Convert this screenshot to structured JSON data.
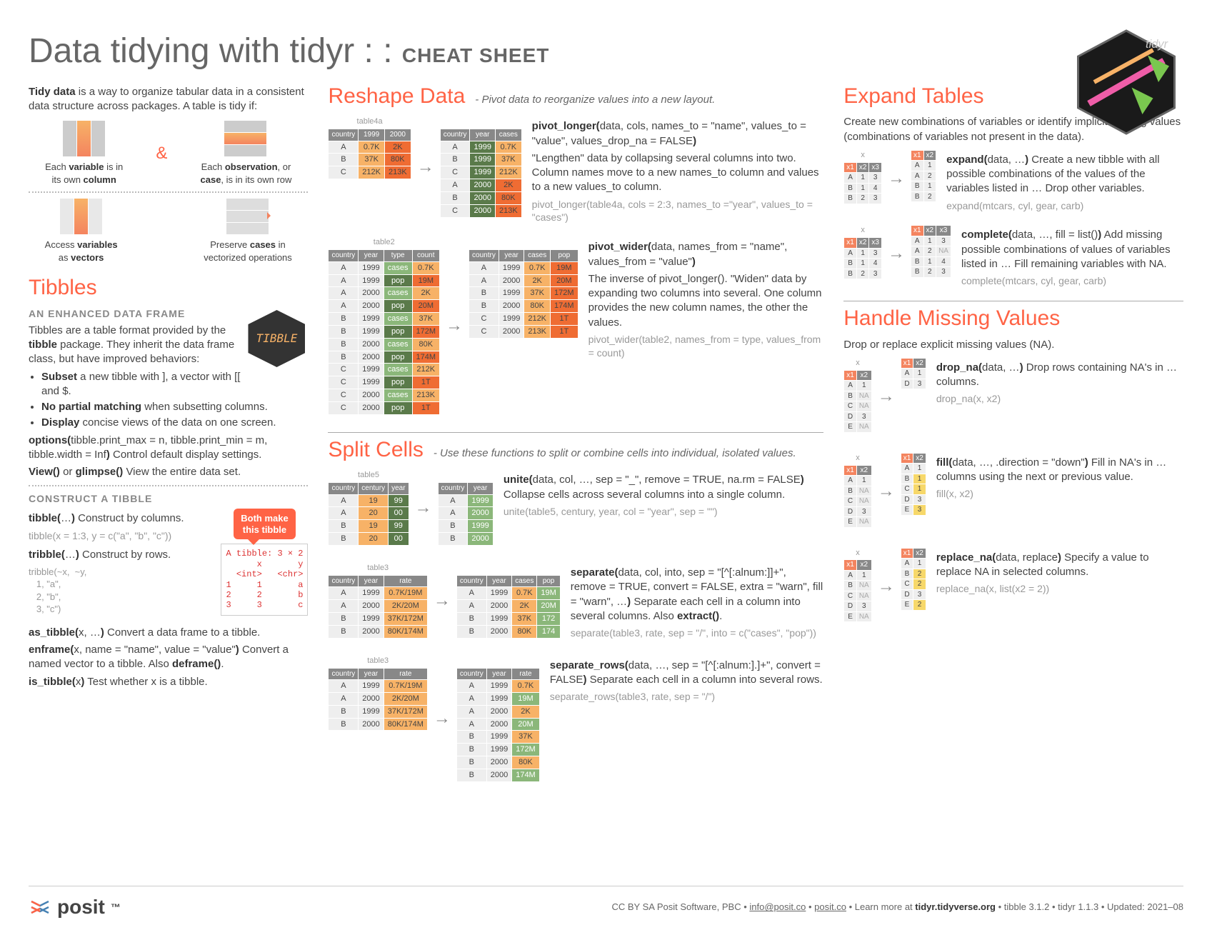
{
  "title_main": "Data tidying with tidyr : : ",
  "title_sub": "CHEAT SHEET",
  "intro": "Tidy data is a way to organize tabular data in a consistent data structure across packages. A table is tidy if:",
  "tidy_a": "Each variable is in its own column",
  "tidy_b": "Each observation, or case, is in its own row",
  "tidy_c": "Access variables as vectors",
  "tidy_d": "Preserve cases in vectorized operations",
  "tibbles": {
    "h": "Tibbles",
    "sub": "AN ENHANCED DATA FRAME",
    "p1": "Tibbles are a table format provided by the tibble package. They inherit the data frame class, but have improved behaviors:",
    "b1": "Subset a new tibble with ], a vector with [[ and $.",
    "b2": "No partial matching when subsetting columns.",
    "b3": "Display concise views of the data on one screen.",
    "opt": "options(tibble.print_max = n, tibble.print_min = m, tibble.width = Inf) Control default display settings.",
    "view": "View() or glimpse() View the entire data set.",
    "construct_h": "CONSTRUCT A TIBBLE",
    "tibble_fn": "tibble(…) Construct by columns.",
    "tibble_ex": "tibble(x = 1:3, y = c(\"a\", \"b\", \"c\"))",
    "tribble_fn": "tribble(…) Construct by rows.",
    "tribble_ex": "tribble(~x,  ~y,\n   1, \"a\",\n   2, \"b\",\n   3, \"c\")",
    "callout": "Both make this tibble",
    "codebox": "A tibble: 3 × 2\n      x       y\n  <int>   <chr>\n1     1       a\n2     2       b\n3     3       c",
    "astibble": "as_tibble(x, …) Convert a data frame to a tibble.",
    "enframe": "enframe(x, name = \"name\", value = \"value\") Convert a named vector to a tibble. Also deframe().",
    "istibble": "is_tibble(x) Test whether x is a tibble."
  },
  "reshape": {
    "h": "Reshape Data",
    "sub": "- Pivot data to reorganize values into a new layout.",
    "pl_sig": "pivot_longer(data, cols, names_to = \"name\", values_to = \"value\", values_drop_na = FALSE)",
    "pl_desc": "\"Lengthen\" data by collapsing several columns into two. Column names move to a new names_to column and values to a new values_to column.",
    "pl_ex": "pivot_longer(table4a, cols = 2:3, names_to =\"year\", values_to = \"cases\")",
    "pw_sig": "pivot_wider(data, names_from = \"name\", values_from = \"value\")",
    "pw_desc": "The inverse of pivot_longer(). \"Widen\" data by expanding two columns into several. One column provides the new column names, the other the values.",
    "pw_ex": "pivot_wider(table2, names_from = type, values_from = count)"
  },
  "split": {
    "h": "Split Cells",
    "sub": "- Use these functions to split or combine cells into individual, isolated values.",
    "unite_sig": "unite(data, col, …, sep = \"_\", remove = TRUE, na.rm = FALSE) Collapse cells across several columns into a single column.",
    "unite_ex": "unite(table5, century, year, col = \"year\", sep = \"\")",
    "sep_sig": "separate(data, col, into, sep = \"[^[:alnum:]]+\", remove = TRUE, convert = FALSE, extra = \"warn\", fill = \"warn\", …) Separate each cell in a column into several columns. Also extract().",
    "sep_ex": "separate(table3, rate, sep = \"/\", into = c(\"cases\", \"pop\"))",
    "sr_sig": "separate_rows(data, …, sep = \"[^[:alnum:].]+\", convert = FALSE) Separate each cell in a column into several rows.",
    "sr_ex": "separate_rows(table3, rate, sep = \"/\")"
  },
  "expand": {
    "h": "Expand Tables",
    "p": "Create new combinations of variables or identify implicit missing values (combinations of variables not present in the data).",
    "exp_sig": "expand(data, …) Create a new tibble with all possible combinations of the values of the variables listed in … Drop other variables.",
    "exp_ex": "expand(mtcars, cyl, gear, carb)",
    "comp_sig": "complete(data, …, fill = list()) Add missing possible combinations of values of variables listed in … Fill remaining variables with NA.",
    "comp_ex": "complete(mtcars, cyl, gear, carb)"
  },
  "missing": {
    "h": "Handle Missing Values",
    "p": "Drop or replace explicit missing values (NA).",
    "drop_sig": "drop_na(data, …) Drop rows containing NA's in … columns.",
    "drop_ex": "drop_na(x, x2)",
    "fill_sig": "fill(data, …, .direction = \"down\") Fill in NA's in … columns using the next or previous value.",
    "fill_ex": "fill(x, x2)",
    "rep_sig": "replace_na(data, replace) Specify a value to replace NA in selected columns.",
    "rep_ex": "replace_na(x, list(x2 = 2))"
  },
  "tables": {
    "t4a_name": "table4a",
    "t4a_h": [
      "country",
      "1999",
      "2000"
    ],
    "t4a_r": [
      [
        "A",
        "0.7K",
        "2K"
      ],
      [
        "B",
        "37K",
        "80K"
      ],
      [
        "C",
        "212K",
        "213K"
      ]
    ],
    "t4a_long_h": [
      "country",
      "year",
      "cases"
    ],
    "t4a_long_r": [
      [
        "A",
        "1999",
        "0.7K"
      ],
      [
        "B",
        "1999",
        "37K"
      ],
      [
        "C",
        "1999",
        "212K"
      ],
      [
        "A",
        "2000",
        "2K"
      ],
      [
        "B",
        "2000",
        "80K"
      ],
      [
        "C",
        "2000",
        "213K"
      ]
    ],
    "t2_name": "table2",
    "t2_h": [
      "country",
      "year",
      "type",
      "count"
    ],
    "t2_r": [
      [
        "A",
        "1999",
        "cases",
        "0.7K"
      ],
      [
        "A",
        "1999",
        "pop",
        "19M"
      ],
      [
        "A",
        "2000",
        "cases",
        "2K"
      ],
      [
        "A",
        "2000",
        "pop",
        "20M"
      ],
      [
        "B",
        "1999",
        "cases",
        "37K"
      ],
      [
        "B",
        "1999",
        "pop",
        "172M"
      ],
      [
        "B",
        "2000",
        "cases",
        "80K"
      ],
      [
        "B",
        "2000",
        "pop",
        "174M"
      ],
      [
        "C",
        "1999",
        "cases",
        "212K"
      ],
      [
        "C",
        "1999",
        "pop",
        "1T"
      ],
      [
        "C",
        "2000",
        "cases",
        "213K"
      ],
      [
        "C",
        "2000",
        "pop",
        "1T"
      ]
    ],
    "t2_wide_h": [
      "country",
      "year",
      "cases",
      "pop"
    ],
    "t2_wide_r": [
      [
        "A",
        "1999",
        "0.7K",
        "19M"
      ],
      [
        "A",
        "2000",
        "2K",
        "20M"
      ],
      [
        "B",
        "1999",
        "37K",
        "172M"
      ],
      [
        "B",
        "2000",
        "80K",
        "174M"
      ],
      [
        "C",
        "1999",
        "212K",
        "1T"
      ],
      [
        "C",
        "2000",
        "213K",
        "1T"
      ]
    ],
    "t5_name": "table5",
    "t5_h": [
      "country",
      "century",
      "year"
    ],
    "t5_r": [
      [
        "A",
        "19",
        "99"
      ],
      [
        "A",
        "20",
        "00"
      ],
      [
        "B",
        "19",
        "99"
      ],
      [
        "B",
        "20",
        "00"
      ]
    ],
    "t5_out_h": [
      "country",
      "year"
    ],
    "t5_out_r": [
      [
        "A",
        "1999"
      ],
      [
        "A",
        "2000"
      ],
      [
        "B",
        "1999"
      ],
      [
        "B",
        "2000"
      ]
    ],
    "t3_name": "table3",
    "t3_h": [
      "country",
      "year",
      "rate"
    ],
    "t3_r": [
      [
        "A",
        "1999",
        "0.7K/19M"
      ],
      [
        "A",
        "2000",
        "2K/20M"
      ],
      [
        "B",
        "1999",
        "37K/172M"
      ],
      [
        "B",
        "2000",
        "80K/174M"
      ]
    ],
    "t3_sep_h": [
      "country",
      "year",
      "cases",
      "pop"
    ],
    "t3_sep_r": [
      [
        "A",
        "1999",
        "0.7K",
        "19M"
      ],
      [
        "A",
        "2000",
        "2K",
        "20M"
      ],
      [
        "B",
        "1999",
        "37K",
        "172"
      ],
      [
        "B",
        "2000",
        "80K",
        "174"
      ]
    ],
    "t3_rows_h": [
      "country",
      "year",
      "rate"
    ],
    "t3_rows_r": [
      [
        "A",
        "1999",
        "0.7K"
      ],
      [
        "A",
        "1999",
        "19M"
      ],
      [
        "A",
        "2000",
        "2K"
      ],
      [
        "A",
        "2000",
        "20M"
      ],
      [
        "B",
        "1999",
        "37K"
      ],
      [
        "B",
        "1999",
        "172M"
      ],
      [
        "B",
        "2000",
        "80K"
      ],
      [
        "B",
        "2000",
        "174M"
      ]
    ],
    "exp_in_h": [
      "x1",
      "x2",
      "x3"
    ],
    "exp_in_r": [
      [
        "A",
        "1",
        "3"
      ],
      [
        "B",
        "1",
        "4"
      ],
      [
        "B",
        "2",
        "3"
      ]
    ],
    "exp_out_h": [
      "x1",
      "x2"
    ],
    "exp_out_r": [
      [
        "A",
        "1"
      ],
      [
        "A",
        "2"
      ],
      [
        "B",
        "1"
      ],
      [
        "B",
        "2"
      ]
    ],
    "comp_out_h": [
      "x1",
      "x2",
      "x3"
    ],
    "comp_out_r": [
      [
        "A",
        "1",
        "3"
      ],
      [
        "A",
        "2",
        "NA"
      ],
      [
        "B",
        "1",
        "4"
      ],
      [
        "B",
        "2",
        "3"
      ]
    ],
    "na_in_h": [
      "x1",
      "x2"
    ],
    "na_in_r": [
      [
        "A",
        "1"
      ],
      [
        "B",
        "NA"
      ],
      [
        "C",
        "NA"
      ],
      [
        "D",
        "3"
      ],
      [
        "E",
        "NA"
      ]
    ],
    "drop_out_r": [
      [
        "A",
        "1"
      ],
      [
        "D",
        "3"
      ]
    ],
    "fill_out_r": [
      [
        "A",
        "1"
      ],
      [
        "B",
        "1"
      ],
      [
        "C",
        "1"
      ],
      [
        "D",
        "3"
      ],
      [
        "E",
        "3"
      ]
    ],
    "rep_out_r": [
      [
        "A",
        "1"
      ],
      [
        "B",
        "2"
      ],
      [
        "C",
        "2"
      ],
      [
        "D",
        "3"
      ],
      [
        "E",
        "2"
      ]
    ]
  },
  "footer": {
    "brand": "posit",
    "text": "CC BY SA Posit Software, PBC • info@posit.co • posit.co • Learn more at tidyr.tidyverse.org • tibble 3.1.2 • tidyr 1.1.3 • Updated: 2021–08"
  }
}
